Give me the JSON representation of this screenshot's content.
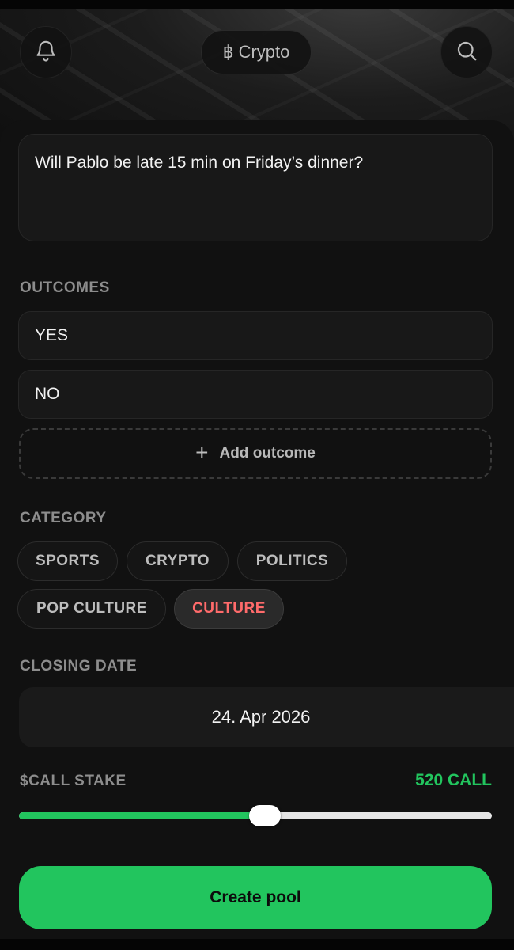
{
  "header": {
    "category_symbol": "฿",
    "category_label": "Crypto",
    "icons": {
      "left": "bell-icon",
      "right": "search-icon"
    }
  },
  "question": {
    "text": "Will Pablo be late 15 min on Friday’s dinner?"
  },
  "outcomes": {
    "label": "OUTCOMES",
    "items": [
      "YES",
      "NO"
    ],
    "add_label": "Add outcome"
  },
  "category": {
    "label": "CATEGORY",
    "chips": [
      "SPORTS",
      "CRYPTO",
      "POLITICS",
      "POP CULTURE",
      "CULTURE"
    ],
    "selected": "CULTURE"
  },
  "closing_date": {
    "label": "CLOSING DATE",
    "value": "24. Apr 2026"
  },
  "stake": {
    "label": "$CALL STAKE",
    "value": "520 CALL",
    "fraction": 0.52
  },
  "create_button": {
    "label": "Create pool"
  },
  "colors": {
    "accent_green": "#22c55e",
    "active_chip_text": "#ff6b6b"
  }
}
